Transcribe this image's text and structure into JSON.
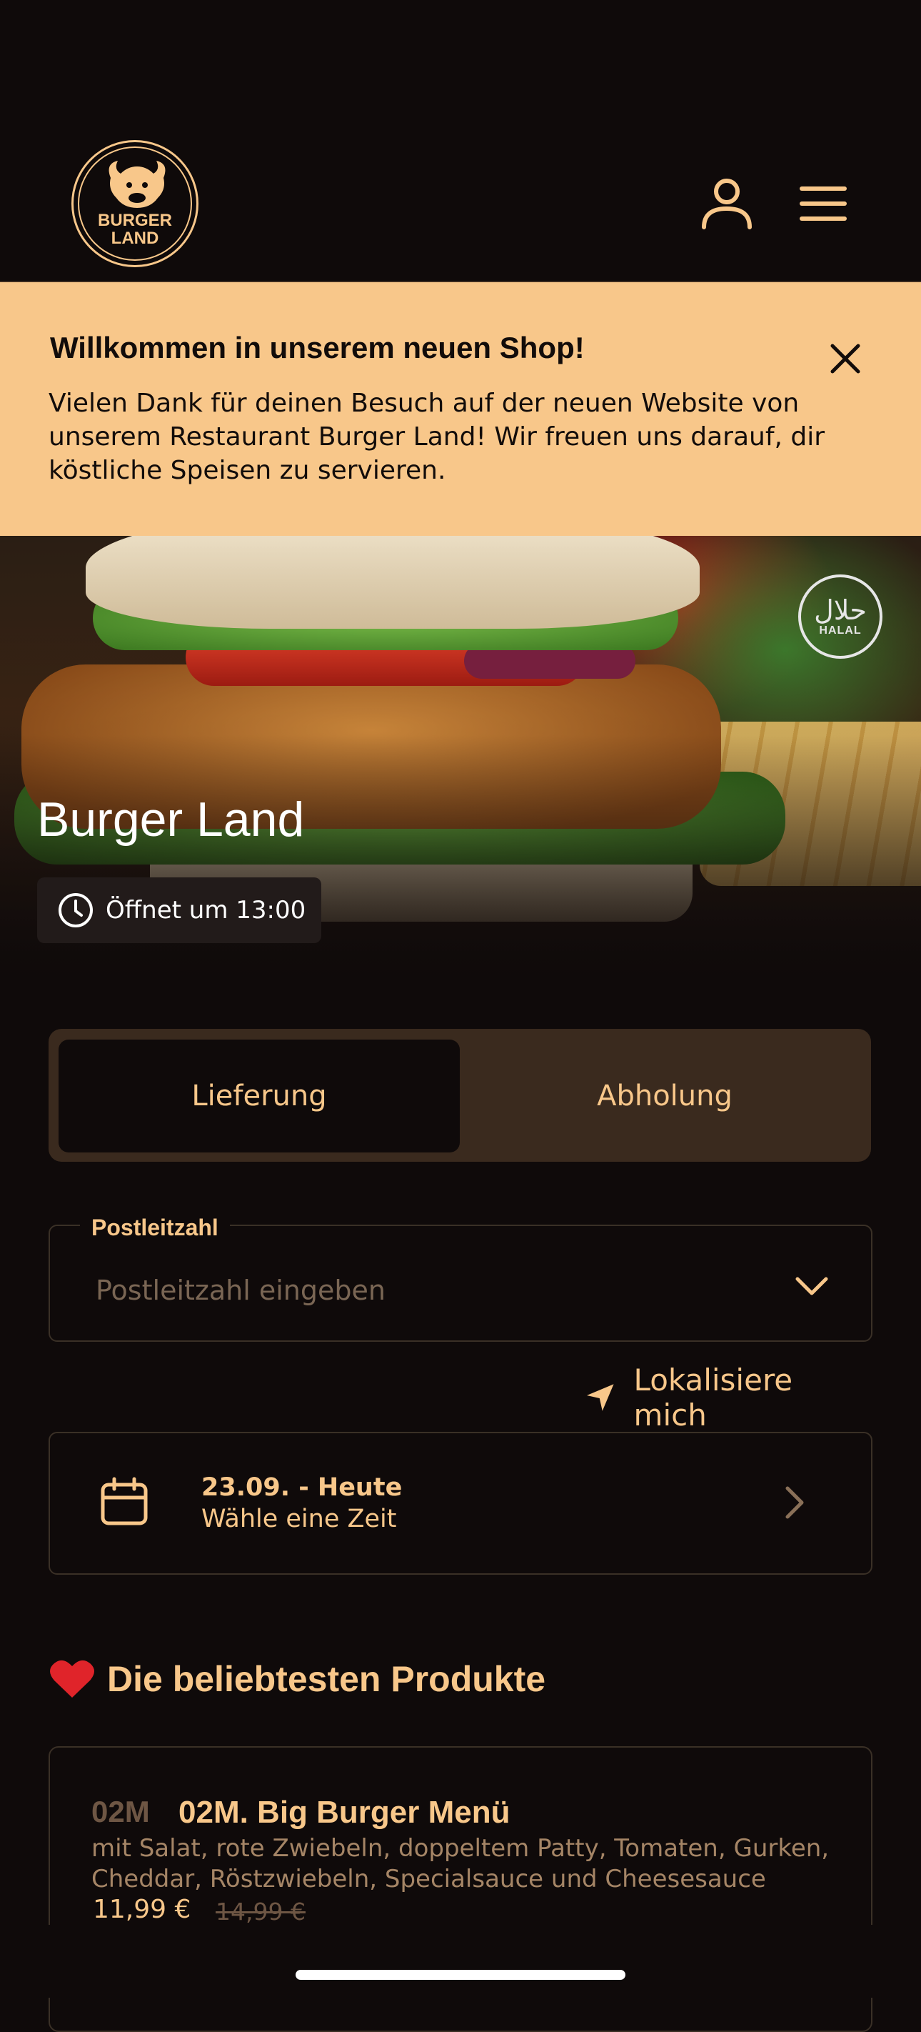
{
  "header": {
    "logo_text_line1": "BURGER",
    "logo_text_line2": "LAND"
  },
  "banner": {
    "title": "Willkommen in unserem neuen Shop!",
    "text": "Vielen Dank für deinen Besuch auf der neuen Website von unserem Restaurant Burger Land! Wir freuen uns darauf, dir köstliche Speisen zu servieren."
  },
  "hero": {
    "restaurant_name": "Burger Land",
    "halal_arabic": "حلال",
    "halal_label": "HALAL",
    "open_status": "Öffnet um 13:00"
  },
  "order_mode": {
    "tabs": [
      {
        "label": "Lieferung",
        "selected": true
      },
      {
        "label": "Abholung",
        "selected": false
      }
    ]
  },
  "postal_code": {
    "label": "Postleitzahl",
    "placeholder": "Postleitzahl eingeben",
    "value": ""
  },
  "locate": {
    "label": "Lokalisiere mich"
  },
  "schedule": {
    "date": "23.09. - Heute",
    "subtitle": "Wähle eine Zeit"
  },
  "popular": {
    "emoji": "❤️",
    "title": "Die beliebtesten Produkte",
    "products": [
      {
        "code": "02M",
        "name": "02M. Big Burger Menü",
        "description": "mit Salat, rote Zwiebeln, doppeltem Patty, Tomaten, Gurken, Cheddar, Röstzwiebeln, Specialsauce und Cheesesauce",
        "price": "11,99 €",
        "old_price": "14,99 €"
      }
    ]
  },
  "colors": {
    "background": "#0f0a0a",
    "accent": "#f8c78a",
    "toggle_bg": "#3a2a1e",
    "border": "#3a3026"
  },
  "icons": [
    "user-icon",
    "menu-icon",
    "close-icon",
    "clock-icon",
    "chevron-down-icon",
    "location-arrow-icon",
    "calendar-icon",
    "chevron-right-icon",
    "heart-icon"
  ]
}
